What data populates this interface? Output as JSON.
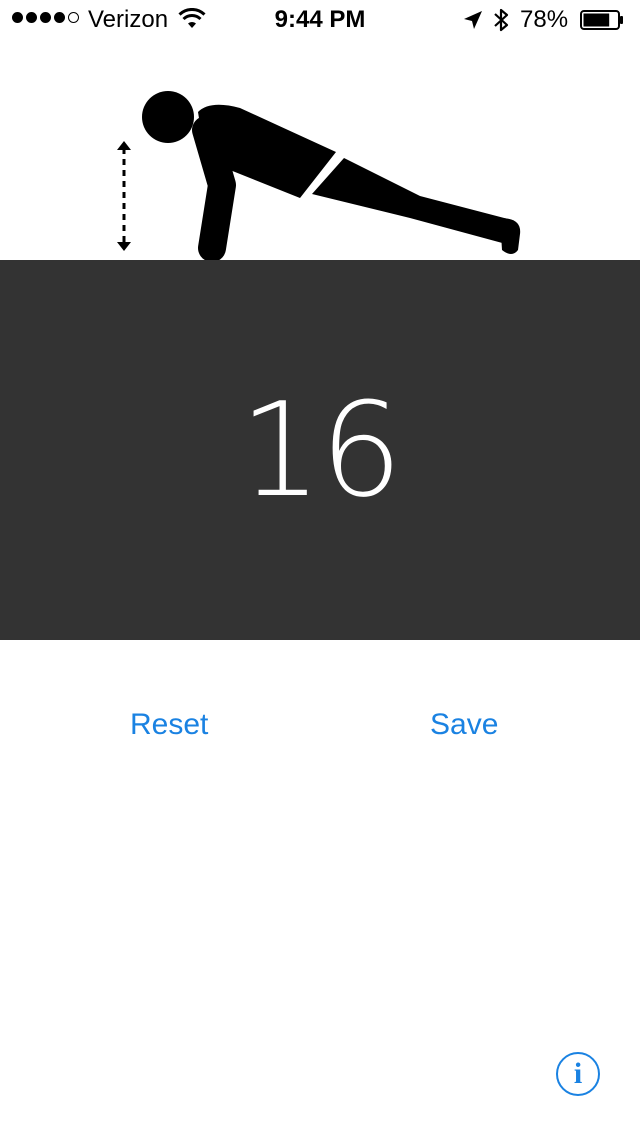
{
  "status_bar": {
    "signal_bars_filled": 4,
    "signal_bars_total": 5,
    "carrier": "Verizon",
    "time": "9:44 PM",
    "battery_percent": "78%",
    "battery_level": 0.78
  },
  "counter": {
    "value": "16"
  },
  "actions": {
    "reset_label": "Reset",
    "save_label": "Save"
  },
  "info": {
    "glyph": "i"
  },
  "colors": {
    "accent": "#1a82e2",
    "panel": "#333333",
    "figure": "#000000"
  },
  "icons": {
    "illustration": "push-up-figure",
    "indicator": "vertical-dashed-arrow"
  }
}
